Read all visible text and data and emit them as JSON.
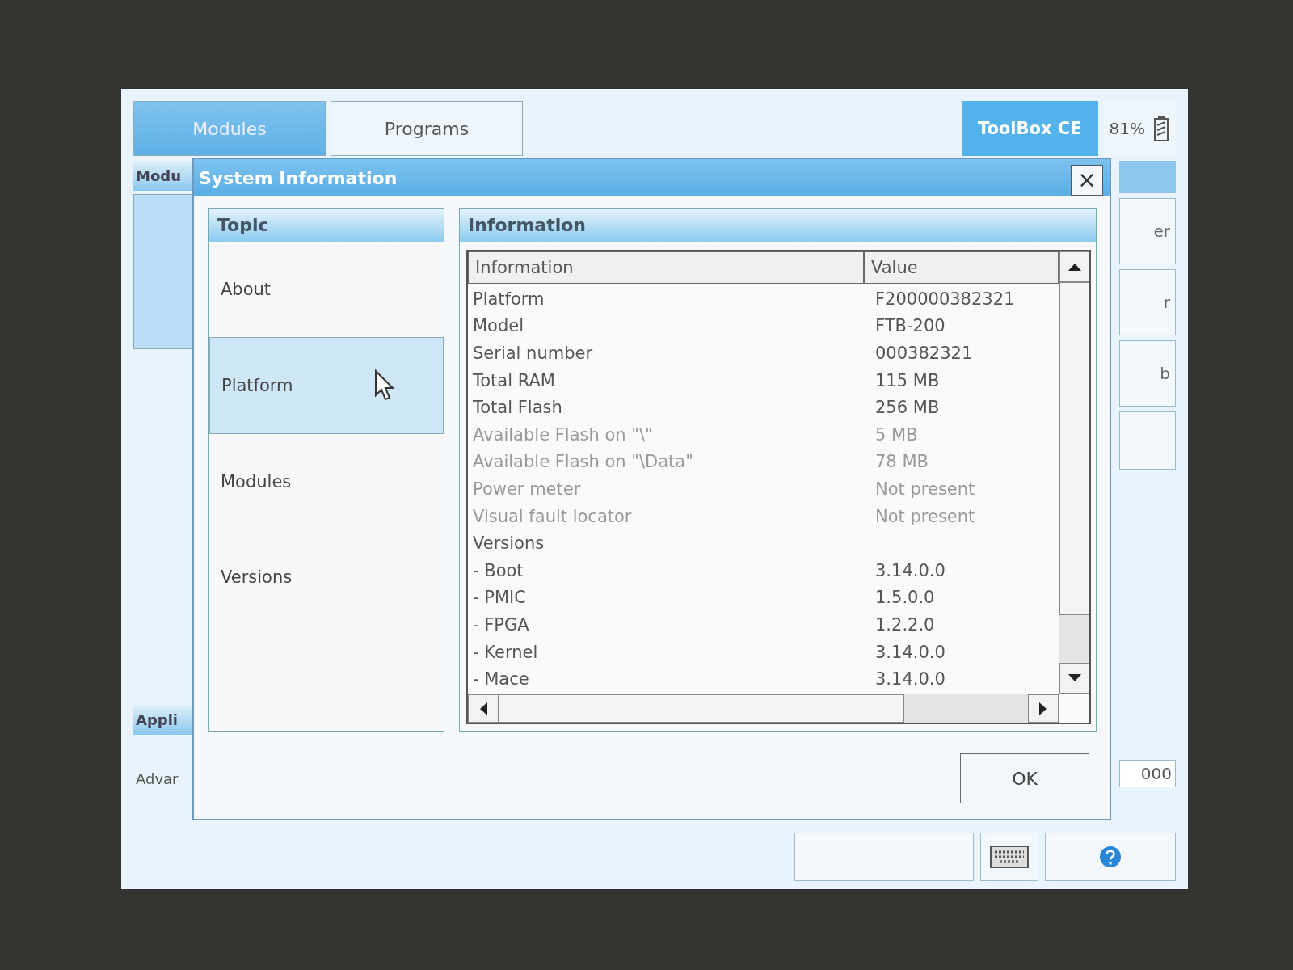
{
  "tabs": [
    {
      "label": "Modules",
      "selected": true
    },
    {
      "label": "Programs",
      "selected": false
    }
  ],
  "app_title": "ToolBox CE",
  "battery": {
    "reading": "81%"
  },
  "background": {
    "panel_title": "Modu",
    "section_title": "Appli",
    "text": "Advar",
    "side_labels": [
      "er",
      "r",
      "b"
    ],
    "status_value": "000"
  },
  "dialog": {
    "title": "System Information",
    "close": "×",
    "topic_header": "Topic",
    "topics": [
      {
        "label": "About",
        "selected": false
      },
      {
        "label": "Platform",
        "selected": true
      },
      {
        "label": "Modules",
        "selected": false
      },
      {
        "label": "Versions",
        "selected": false
      }
    ],
    "info_header": "Information",
    "columns": [
      "Information",
      "Value"
    ],
    "rows": [
      {
        "name": "Platform",
        "value": "F200000382321",
        "dimmed": false
      },
      {
        "name": "Model",
        "value": "FTB-200",
        "dimmed": false
      },
      {
        "name": "Serial number",
        "value": "000382321",
        "dimmed": false
      },
      {
        "name": "Total RAM",
        "value": "115 MB",
        "dimmed": false
      },
      {
        "name": "Total Flash",
        "value": "256 MB",
        "dimmed": false
      },
      {
        "name": "Available Flash on \"\\\"",
        "value": "5 MB",
        "dimmed": true
      },
      {
        "name": "Available Flash on \"\\Data\"",
        "value": "78 MB",
        "dimmed": true
      },
      {
        "name": "Power meter",
        "value": "Not present",
        "dimmed": true
      },
      {
        "name": "Visual fault locator",
        "value": "Not present",
        "dimmed": true
      },
      {
        "name": "Versions",
        "value": "",
        "dimmed": false
      },
      {
        "name": "- Boot",
        "value": "3.14.0.0",
        "dimmed": false
      },
      {
        "name": "- PMIC",
        "value": "1.5.0.0",
        "dimmed": false
      },
      {
        "name": "- FPGA",
        "value": "1.2.2.0",
        "dimmed": false
      },
      {
        "name": "- Kernel",
        "value": "3.14.0.0",
        "dimmed": false
      },
      {
        "name": "- Mace",
        "value": "3.14.0.0",
        "dimmed": false
      }
    ],
    "ok": "OK"
  }
}
